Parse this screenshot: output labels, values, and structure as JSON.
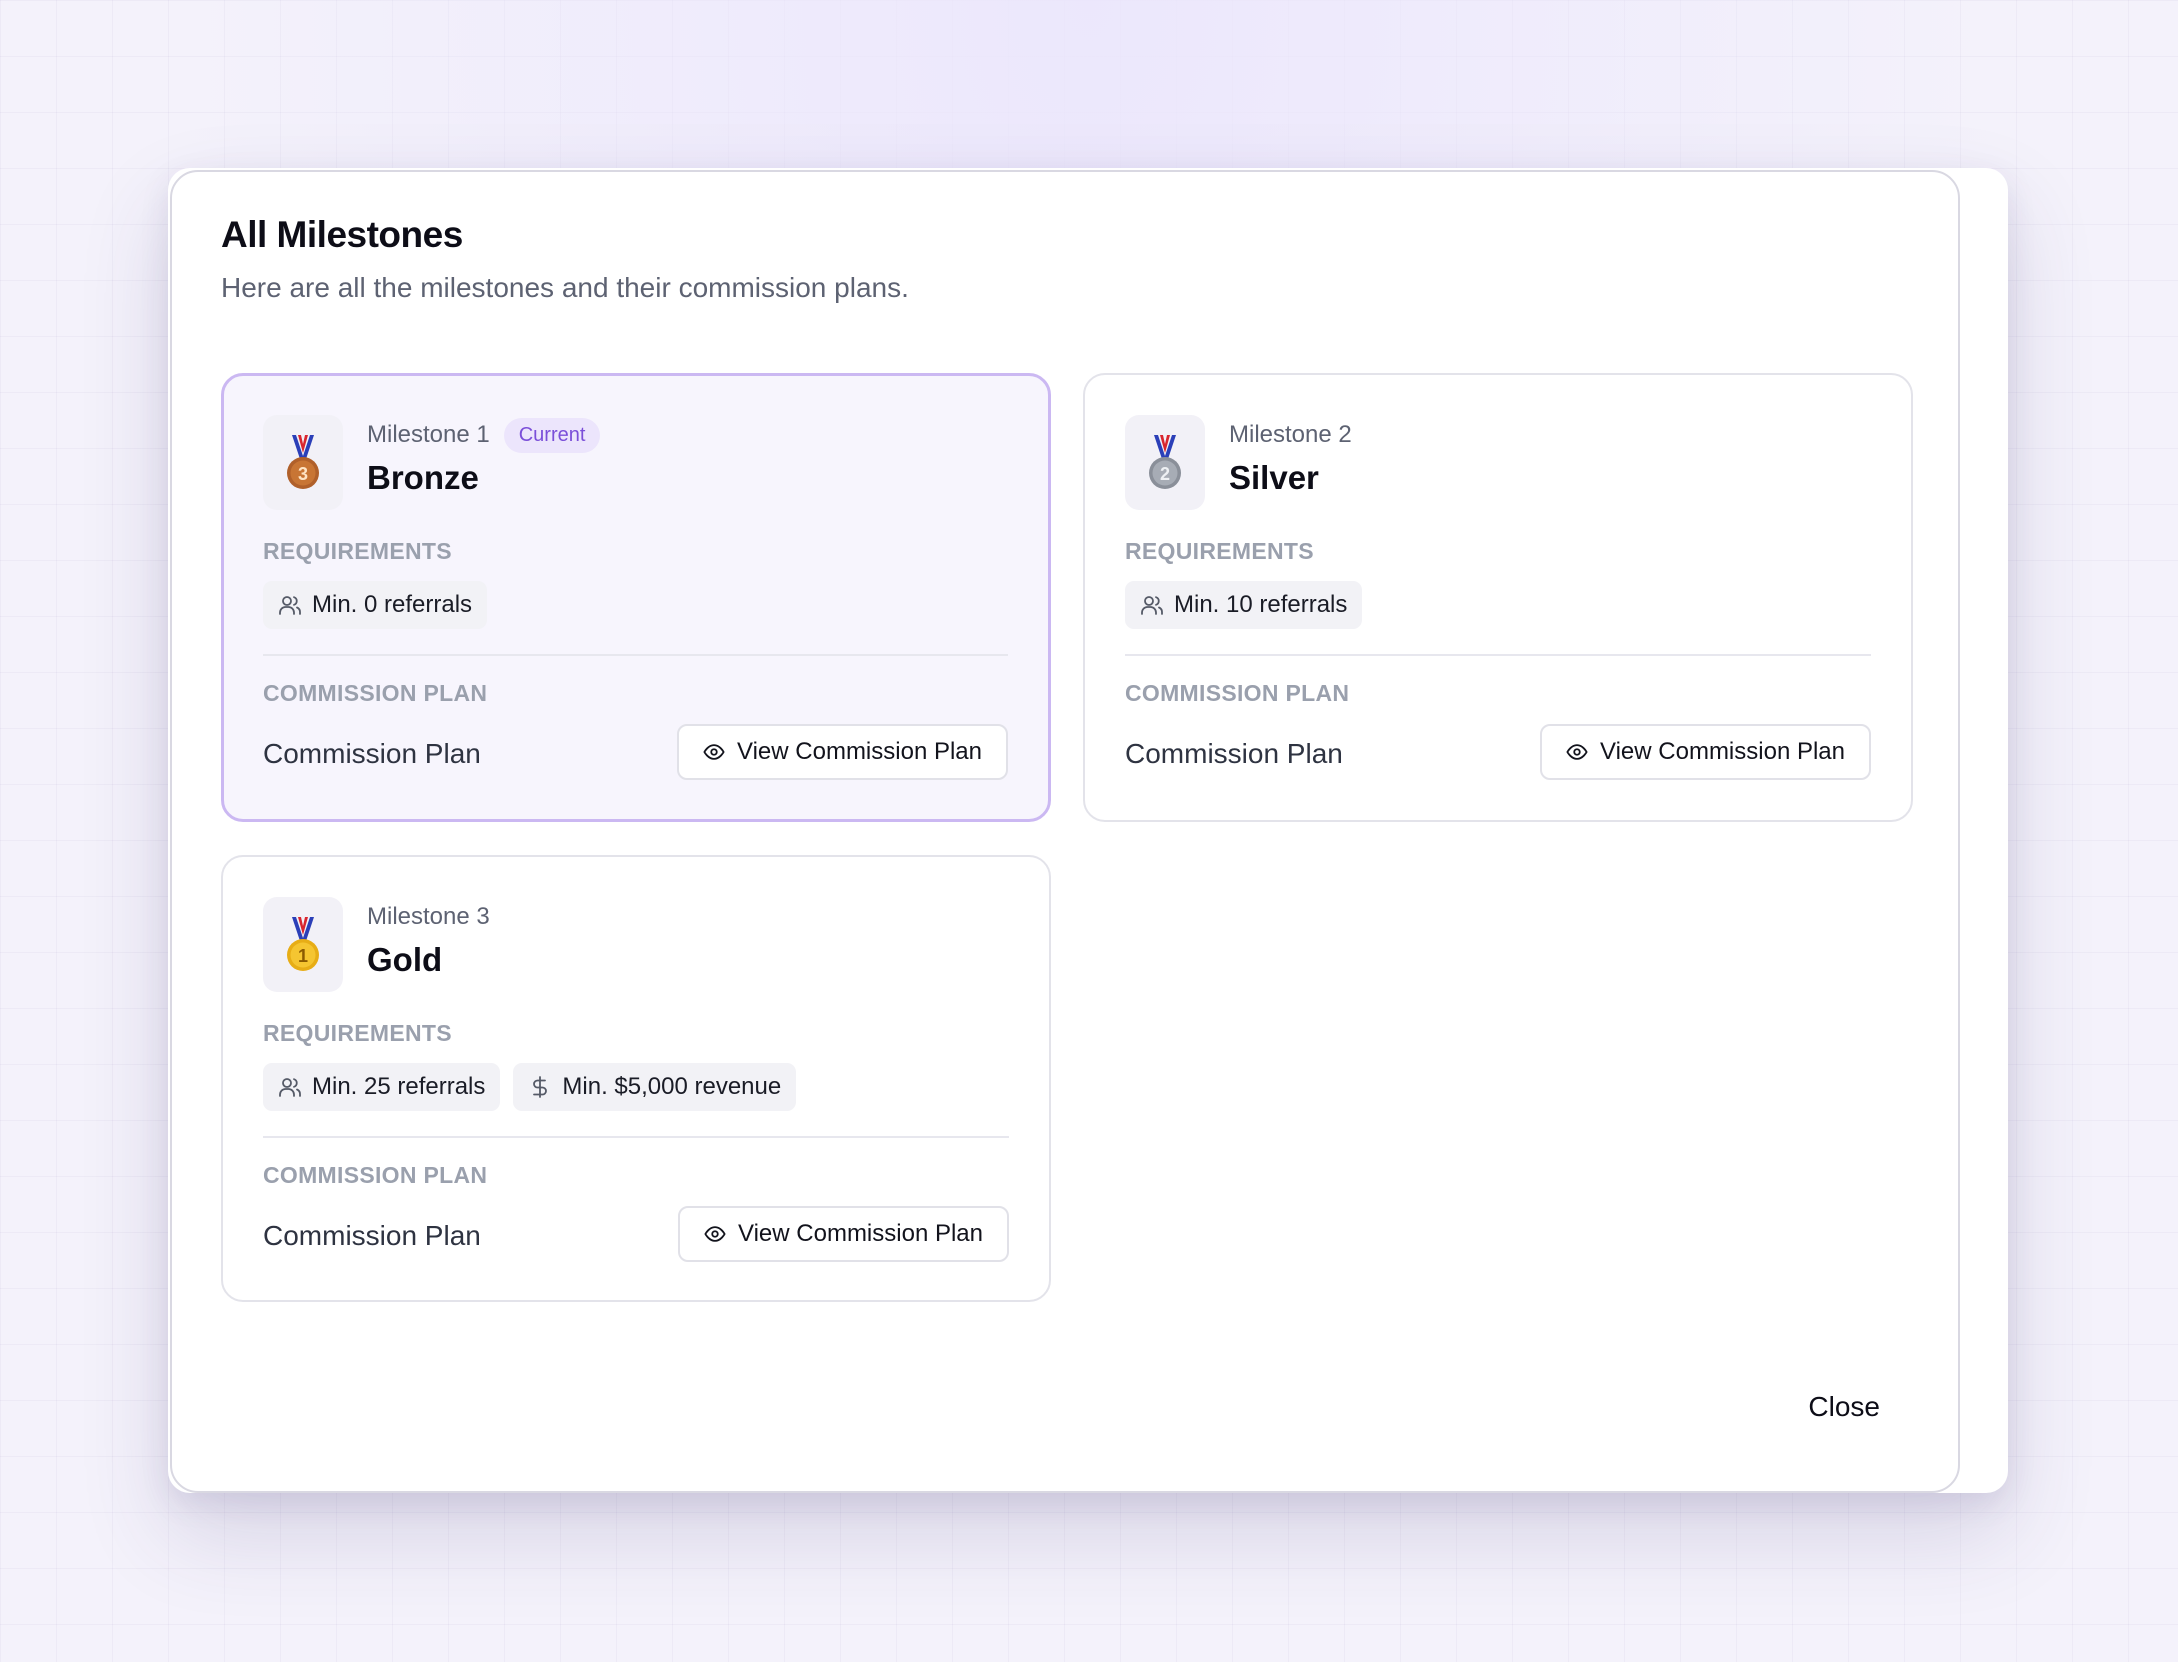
{
  "modal": {
    "title": "All Milestones",
    "subtitle": "Here are all the milestones and their commission plans.",
    "close_label": "Close"
  },
  "sections": {
    "requirements_label": "REQUIREMENTS",
    "commission_plan_label": "COMMISSION PLAN"
  },
  "milestones": [
    {
      "label": "Milestone 1",
      "badge": "Current",
      "name": "Bronze",
      "medal_icon": "bronze-medal-icon",
      "medal_number": "3",
      "medal_color": "#b0602a",
      "requirements": [
        {
          "icon": "users-icon",
          "text": "Min. 0 referrals"
        }
      ],
      "plan_name": "Commission Plan",
      "view_button_label": "View Commission Plan"
    },
    {
      "label": "Milestone 2",
      "name": "Silver",
      "medal_icon": "silver-medal-icon",
      "medal_number": "2",
      "medal_color": "#8a8f99",
      "requirements": [
        {
          "icon": "users-icon",
          "text": "Min. 10 referrals"
        }
      ],
      "plan_name": "Commission Plan",
      "view_button_label": "View Commission Plan"
    },
    {
      "label": "Milestone 3",
      "name": "Gold",
      "medal_icon": "gold-medal-icon",
      "medal_number": "1",
      "medal_color": "#e7ad16",
      "requirements": [
        {
          "icon": "users-icon",
          "text": "Min. 25 referrals"
        },
        {
          "icon": "dollar-icon",
          "text": "Min. $5,000 revenue"
        }
      ],
      "plan_name": "Commission Plan",
      "view_button_label": "View Commission Plan"
    }
  ],
  "colors": {
    "accent": "#7b4fd9",
    "current_card_border": "#cbb8f2",
    "current_card_background": "#f7f5fd"
  }
}
